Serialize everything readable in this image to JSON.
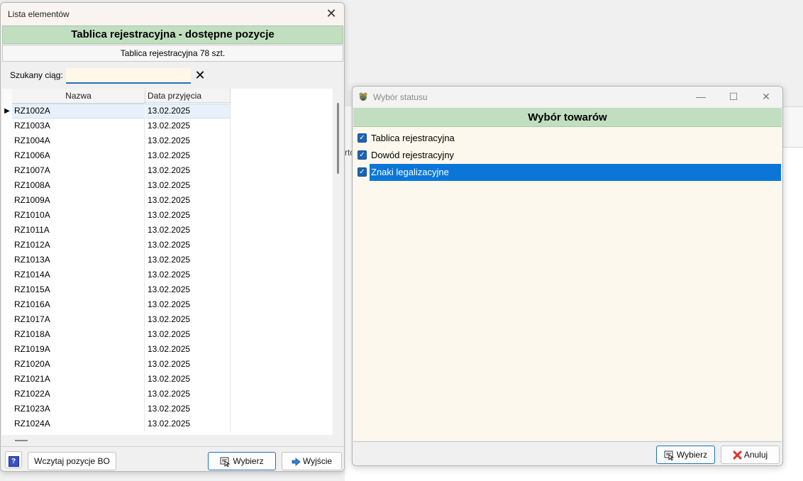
{
  "window1": {
    "title": "Lista elementów",
    "header": "Tablica rejestracyjna - dostępne pozycje",
    "subheader": "Tablica rejestracyjna 78 szt.",
    "search": {
      "label": "Szukany ciąg:",
      "value": "",
      "placeholder": ""
    },
    "grid": {
      "columns": [
        "Nazwa",
        "Data przyjęcia"
      ],
      "rows": [
        [
          "RZ1002A",
          "13.02.2025"
        ],
        [
          "RZ1003A",
          "13.02.2025"
        ],
        [
          "RZ1004A",
          "13.02.2025"
        ],
        [
          "RZ1006A",
          "13.02.2025"
        ],
        [
          "RZ1007A",
          "13.02.2025"
        ],
        [
          "RZ1008A",
          "13.02.2025"
        ],
        [
          "RZ1009A",
          "13.02.2025"
        ],
        [
          "RZ1010A",
          "13.02.2025"
        ],
        [
          "RZ1011A",
          "13.02.2025"
        ],
        [
          "RZ1012A",
          "13.02.2025"
        ],
        [
          "RZ1013A",
          "13.02.2025"
        ],
        [
          "RZ1014A",
          "13.02.2025"
        ],
        [
          "RZ1015A",
          "13.02.2025"
        ],
        [
          "RZ1016A",
          "13.02.2025"
        ],
        [
          "RZ1017A",
          "13.02.2025"
        ],
        [
          "RZ1018A",
          "13.02.2025"
        ],
        [
          "RZ1019A",
          "13.02.2025"
        ],
        [
          "RZ1020A",
          "13.02.2025"
        ],
        [
          "RZ1021A",
          "13.02.2025"
        ],
        [
          "RZ1022A",
          "13.02.2025"
        ],
        [
          "RZ1023A",
          "13.02.2025"
        ],
        [
          "RZ1024A",
          "13.02.2025"
        ]
      ]
    },
    "buttons": {
      "load": "Wczytaj pozycje BO",
      "select": "Wybierz",
      "exit": "Wyjście"
    }
  },
  "window2": {
    "title": "Wybór statusu",
    "header": "Wybór towarów",
    "items": [
      {
        "label": "Tablica rejestracyjna",
        "checked": true
      },
      {
        "label": "Dowód rejestracyjny",
        "checked": true
      },
      {
        "label": "Znaki legalizacyjne",
        "checked": true
      }
    ],
    "buttons": {
      "select": "Wybierz",
      "cancel": "Anuluj"
    }
  },
  "background": {
    "peek_text": "rto"
  },
  "colors": {
    "header_green": "#c1dfc0",
    "selection_blue": "#0b76d8",
    "content_cream": "#fdf8ed",
    "checkbox_blue": "#1d64b8"
  }
}
